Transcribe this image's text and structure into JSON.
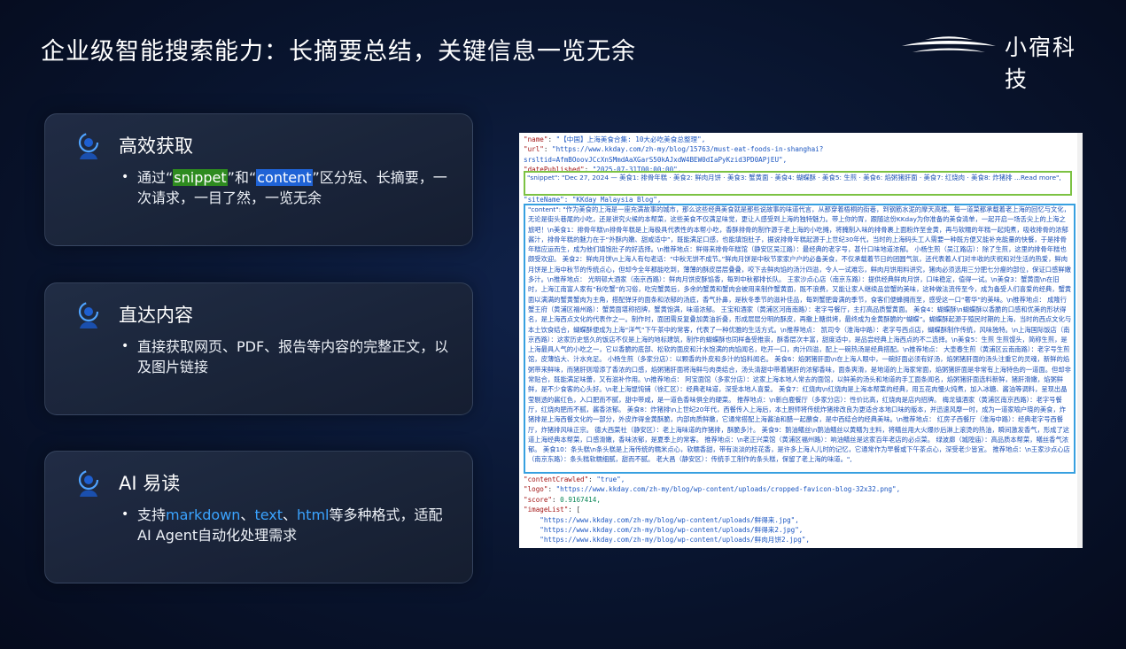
{
  "header": {
    "title": "企业级智能搜索能力：长摘要总结，关键信息一览无余",
    "logo_text": "小宿科技"
  },
  "cards": [
    {
      "title": "高效获取",
      "desc_parts": [
        "通过“",
        "snippet",
        "”和“",
        "content",
        "”区分短、长摘要，一次请求，一目了然，一览无余"
      ]
    },
    {
      "title": "直达内容",
      "desc": "直接获取网页、PDF、报告等内容的完整正文，以及图片链接"
    },
    {
      "title": "AI 易读",
      "desc_parts": [
        "支持",
        "markdown",
        "、",
        "text",
        "、",
        "html",
        "等多种格式，适配AI Agent自动化处理需求"
      ]
    }
  ],
  "screenshot": {
    "lines_top": [
      {
        "key": "\"name\"",
        "val": "\"【中国】上海美食合集: 10大必吃美食总整理\","
      },
      {
        "key": "\"url\"",
        "val": "\"https://www.kkday.com/zh-my/blog/15763/must-eat-foods-in-shanghai?"
      },
      {
        "key": "",
        "val": "srsltid=AfmBOoovJCcXnSMmdAaXGarS50kAJxdW4BEW0dIaPyKzid3PD0APjEU\","
      },
      {
        "key": "\"datePublished\"",
        "val": "\"2025-07-31T00:00:00\","
      }
    ],
    "snippet": "\"snippet\": \"Dec 27, 2024 — 美食1: 排骨年糕 · 美食2: 鲜肉月饼 · 美食3: 蟹黄面 · 美食4: 蝴蝶酥 · 美食5: 生煎 · 美食6: 焰粥猪肝面 · 美食7: 红烧肉 · 美食8: 炸猪排 ...Read more\",",
    "site_name_line": "\"siteName\": \"KKday Malaysia Blog\",",
    "content": "\"content\": \"作为美食的上海是一座充满故事的城市，那么这些经典美食就是那些说故事的味道代言，从那穿着梧桐的街巷，到钢筋水泥的摩天高楼。每一道菜都承载着老上海的回忆与文化，无论是街头巷尾的小吃，还是讲究火候的本帮菜，这些美食不仅满足味觉，更让人感受到上海的独特魅力。带上你的胃，跟随这份KKday为你准备的美食清单，一起开启一场舌尖上的上海之旅吧！\\n美食1：排骨年糕\\n排骨年糕是上海极具代表性的本帮小吃，香酥排骨的制作源于老上海的小吃摊，将腌制入味的排骨裹上面粉炸至金黄，再与软糯的年糕一起炖煮，吸收排骨的浓郁酱汁，排骨年糕的魅力在于“外酥内嫩、甜咸适中”，既能满足口感，也能填饱肚子，据说排骨年糕起源于上世纪30年代，当时的上海码头工人需要一种既方便又能补充能量的快餐，于是排骨年糕应运而生，成为他们填饱肚子的好选择。\\n推荐地点：鲜得来排骨年糕馆（静安区吴江路）：最经典的老字号，甚什口味地道浓郁。 小杨生煎（吴江路店）：除了生煎，这里的排骨年糕也颇受欢迎。 美食2：鲜肉月饼\\n上海人有句老话：“中秋无饼不成节。”鲜肉月饼是中秋节家家户户的必备美食，不仅承载着节日的团圆气氛，还代表着人们对丰收的庆祝和对生活的热爱，鲜肉月饼是上海中秋节的传统点心，但却今全年都能吃到，薄薄的酥皮层层叠叠，咬下去鲜肉馅的汤汁四溢，令人一试难忘，鲜肉月饼用料讲究，猪肉必须选用三分肥七分瘦的部位，保证口感鲜嫩多汁。\\n推荐地点： 光明邨大酒家（南京西路）：鲜肉月饼皮酥馅香，每到中秋都排长队。 王家沙点心店（南京东路）：提供经典鲜肉月饼，口味稳定，值得一试。\\n美食3：蟹黄面\\n在旧时，上海江南富人家有“秋吃蟹”的习俗，吃完蟹黄后，多余的蟹黄和蟹肉会被用来制作蟹黄面，既不浪费，又能让家人继续品尝蟹的美味，这种做法流传至今，成为备受人们喜爱的经典，蟹黄面以满满的蟹黄蟹肉为主角，搭配弹牙的面条和浓郁的汤底，香气扑鼻，是秋冬季节的滋补佳品，每到蟹肥膏满的季节，食客们便蜂拥而至，感受这一口“奢华”的美味。\\n推荐地点： 成隆行蟹王府（黄浦区福州路）：蟹黄面堪称招牌，蟹黄饱满，味道浓郁。 王宝和酒家（黄浦区河南南路）：老字号餐厅，主打高品质蟹黄面。 美食4：蝴蝶酥\\n蝴蝶酥以香脆的口感和优美的形状得名，是上海西点文化的代表作之一。制作时，面团需反复叠加黄油折叠，形成层层分明的酥皮，再撒上糖烘烤，最终成为金黄酥脆的“蝴蝶”。蝴蝶酥起源于殖民时期的上海，当时的西点文化与本土饮食结合，蝴蝶酥便成为上海“洋气”下午茶中的常客，代表了一种优雅的生活方式。\\n推荐地点： 凯司令（淮海中路）：老字号西点店，蝴蝶酥制作传统，风味独特。\\n上海国际饭店（南京西路）：这家历史悠久的饭店不仅是上海的地标建筑，制作的蝴蝶酥也同样备受推崇，酥香层次丰富，甜度适中，是品尝经典上海西点的不二选择。\\n美食5：生煎 生煎馒头，简称生煎，是上海最具人气的小吃之一，它以香脆的底部、松软的面皮和汁水饱满的肉馅闻名，吃开一口，肉汁四溢，配上一碗热汤是经典搭配。\\n推荐地点： 大壶春生煎（黄浦区云南南路）：老字号生煎馆，皮薄馅大、汁水充足。 小杨生煎（多家分店）：以颗香的外皮和多汁的馅料闻名。 美食6：焰粥猪肝面\\n在上海人眼中，一碗好面必须有好汤，焰粥猪肝面的汤头注重它的灵魂，新鲜的焰粥带来鲜味，而猪肝则增添了香浓的口感，焰粥猪肝面将海鲜与肉类结合，汤头清甜中带着猪肝的浓郁香味，面条爽滑，是地道的上海家常面，焰粥猪肝面是非常有上海特色的一道面。但却非常贴合，既能满足味蕾，又有滋补作用。\\n推荐地点： 阿宝面馆（多家分店）：这家上海本地人常去的面馆，以鲜美的汤头和地道的手工面条闻名，焰粥猪肝面选料新鲜，猪肝滑嫩，焰粥鲜鲜，是不少食客的心头好。\\n老上海馄饨铺（徐汇区）：经典老味道，深受本地人喜爱。 美食7：红烧肉\\n红烧肉是上海本帮菜的经典，用五花肉慢火炖煮，加入冰糖、酱油等调料，呈现出晶莹剔透的酱红色，入口肥而不腻，甜中带咸，是一道色香味俱全的硬菜。 推荐地点：\\n新白鹿餐厅（多家分店）：性价比高，红烧肉是店内招牌。 梅龙镇酒家（黄浦区南京西路）：老字号餐厅，红烧肉肥而不腻，酱香浓郁。 美食8：炸猪排\\n上世纪20年代，西餐传入上海后，本土厨师将传统炸猪排改良为更适合本地口味的版本，并迅速风靡一时，成为一道家喻户晓的美食，炸猪排是上海西餐文化的一部分，外皮炸得金黄酥脆，内部肉质鲜嫩，它通常搭配上海酱油和醋一起蘸食，是中西结合的经典美味。\\n推荐地点： 红房子西餐厅（淮海中路）：经典老字号西餐厅，炸猪排风味正宗。 德大西菜社（静安区）：老上海味道的炸猪排，酥脆多汁。 美食9：鹅油鳝丝\\n鹅油鳝丝以黄鳝为主料，将鳝丝用大火爆炒后淋上滚烫的热油，瞬间激发香气，形成了这道上海经典本帮菜，口感滑嫩，香味浓郁，是夏季上的常客。 推荐地点：\\n老正兴菜馆（黄浦区福州路）：响油鳝丝是这家百年老店的必点菜。 绿波廊（城隍庙）：高品质本帮菜，鳝丝香气浓郁。 美食10：条头糕\\n条头糕是上海传统的糯米点心，软糯香甜，带有淡淡的桂花香，是许多上海人儿时的记忆，它通常作为早餐或下午茶点心，深受老少皆宜。 推荐地点：\\n王家沙点心店（南京东路）：条头糕软糯细腻，甜而不腻。 老大昌（静安区）：传统手工制作的条头糕，保留了老上海的味道。\",",
    "lines_bottom": [
      {
        "key": "\"contentCrawled\"",
        "val": "\"true\","
      },
      {
        "key": "\"logo\"",
        "val": "\"https://www.kkday.com/zh-my/blog/wp-content/uploads/cropped-favicon-blog-32x32.png\","
      },
      {
        "key": "\"score\"",
        "val": "0.9167414,"
      },
      {
        "key": "\"imageList\"",
        "val": "["
      },
      {
        "key": "",
        "val": "    \"https://www.kkday.com/zh-my/blog/wp-content/uploads/鲜得来.jpg\","
      },
      {
        "key": "",
        "val": "    \"https://www.kkday.com/zh-my/blog/wp-content/uploads/鲜得来2.jpg\","
      },
      {
        "key": "",
        "val": "    \"https://www.kkday.com/zh-my/blog/wp-content/uploads/鲜肉月饼2.jpg\","
      }
    ]
  }
}
